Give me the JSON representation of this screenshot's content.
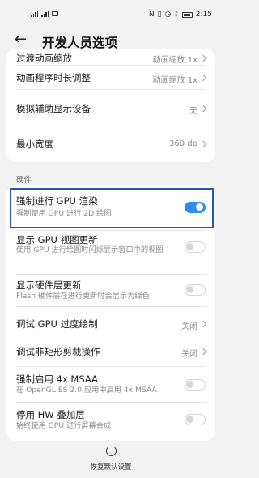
{
  "status_bar": {
    "time": "2:15"
  },
  "header": {
    "title": "开发人员选项"
  },
  "top_card": {
    "rows": [
      {
        "label": "过渡动画缩放",
        "value": "动画缩放 1x"
      },
      {
        "label": "动画程序时长调整",
        "value": "动画缩放 1x"
      },
      {
        "label": "模拟辅助显示设备",
        "value": "无"
      },
      {
        "label": "最小宽度",
        "value": "360 dp"
      }
    ]
  },
  "hardware": {
    "section_label": "硬件",
    "rows": [
      {
        "label": "强制进行 GPU 渲染",
        "sub": "强制使用 GPU 进行 2D 绘图",
        "toggle": true
      },
      {
        "label": "显示 GPU 视图更新",
        "sub": "使用 GPU 进行绘图时闪烁显示窗口中的视图",
        "toggle": false
      },
      {
        "label": "显示硬件层更新",
        "sub": "Flash 硬件层在进行更新时会显示为绿色",
        "toggle": false
      },
      {
        "label": "调试 GPU 过度绘制",
        "value": "关闭"
      },
      {
        "label": "调试非矩形剪裁操作",
        "value": "关闭"
      },
      {
        "label": "强制启用 4x MSAA",
        "sub": "在 OpenGL ES 2.0 应用中启用 4x MSAA",
        "toggle": false
      },
      {
        "label": "停用 HW 叠加层",
        "sub": "始终使用 GPU 进行屏幕合成",
        "toggle": false
      }
    ]
  },
  "footer": {
    "reset_label": "恢复默认设置"
  },
  "colors": {
    "accent": "#2d8cf0",
    "highlight_box": "#2a52be",
    "background": "#f2f2f2"
  }
}
